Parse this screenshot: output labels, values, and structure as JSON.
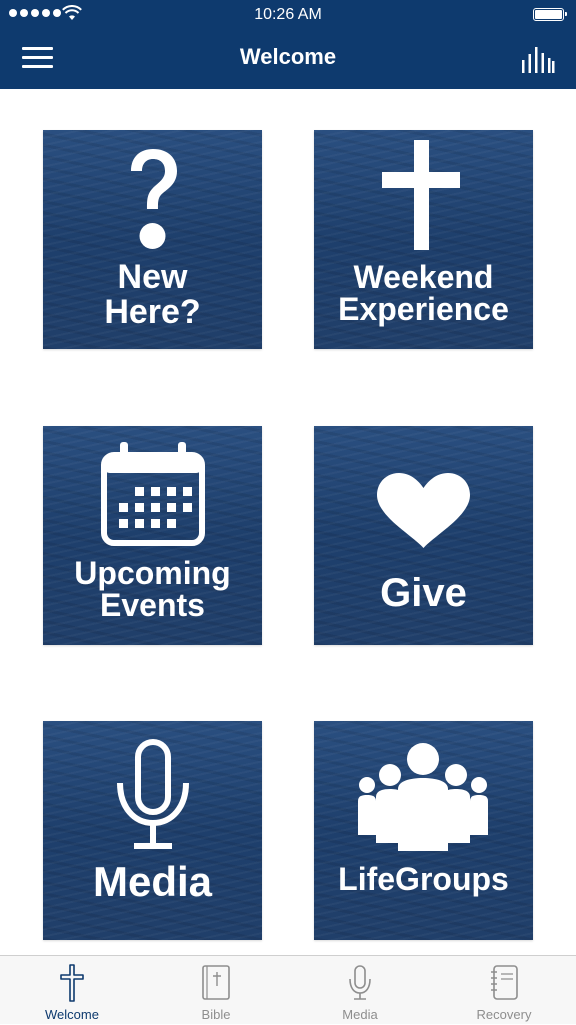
{
  "status_bar": {
    "time": "10:26 AM"
  },
  "nav": {
    "title": "Welcome"
  },
  "tiles": [
    {
      "label_line1": "New",
      "label_line2": "Here?",
      "icon": "question-mark-icon"
    },
    {
      "label_line1": "Weekend",
      "label_line2": "Experience",
      "icon": "cross-icon"
    },
    {
      "label_line1": "Upcoming",
      "label_line2": "Events",
      "icon": "calendar-icon"
    },
    {
      "label_line1": "Give",
      "icon": "heart-icon"
    },
    {
      "label_line1": "Media",
      "icon": "microphone-icon"
    },
    {
      "label_line1": "LifeGroups",
      "icon": "people-group-icon"
    }
  ],
  "tabbar": {
    "tabs": [
      {
        "label": "Welcome",
        "icon": "cross-icon",
        "active": true
      },
      {
        "label": "Bible",
        "icon": "bible-icon",
        "active": false
      },
      {
        "label": "Media",
        "icon": "microphone-icon",
        "active": false
      },
      {
        "label": "Recovery",
        "icon": "notebook-icon",
        "active": false
      }
    ]
  },
  "colors": {
    "brand": "#0e3a6e",
    "tile": "#1f4170",
    "tab_inactive": "#8e8e8e"
  }
}
